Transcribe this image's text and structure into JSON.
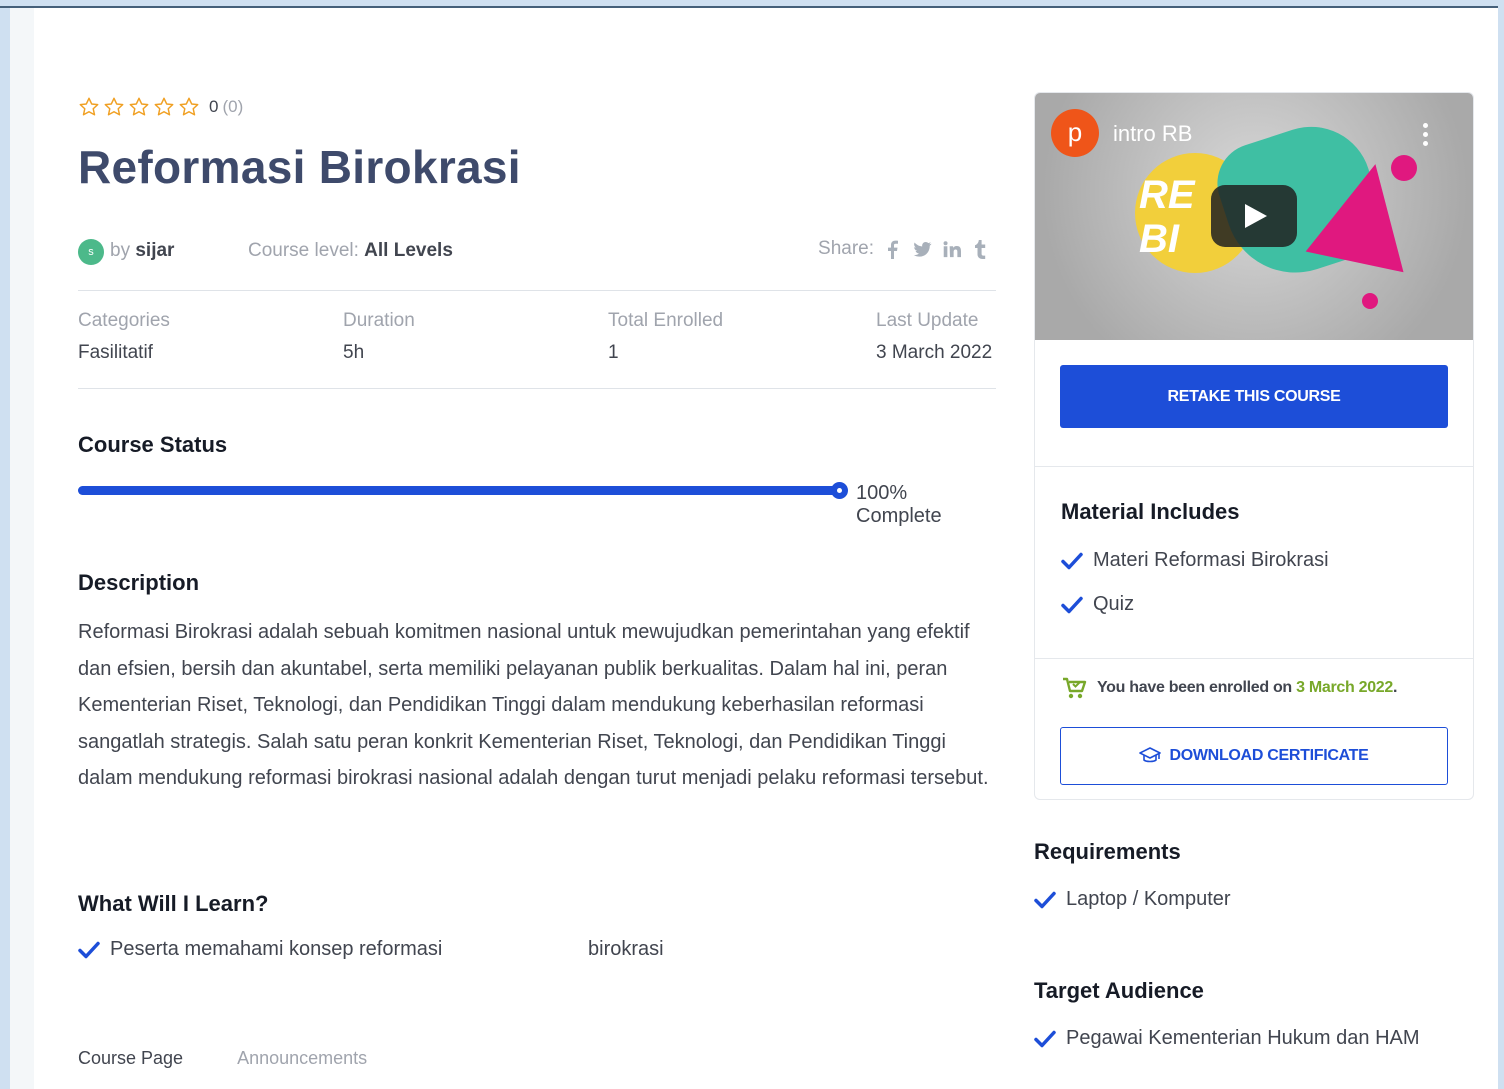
{
  "rating": {
    "value": "0",
    "count": "(0)",
    "stars_filled": 0,
    "stars_total": 5
  },
  "course": {
    "title": "Reformasi Birokrasi"
  },
  "author": {
    "avatar_letter": "s",
    "by_label": "by",
    "name": "sijar"
  },
  "level": {
    "label": "Course level:",
    "value": "All Levels"
  },
  "share": {
    "label": "Share:"
  },
  "info": [
    {
      "label": "Categories",
      "value": "Fasilitatif"
    },
    {
      "label": "Duration",
      "value": "5h"
    },
    {
      "label": "Total Enrolled",
      "value": "1"
    },
    {
      "label": "Last Update",
      "value": "3 March 2022"
    }
  ],
  "status": {
    "heading": "Course Status",
    "progress_percent": 100,
    "progress_text": "100% Complete"
  },
  "description": {
    "heading": "Description",
    "text": "Reformasi Birokrasi adalah sebuah komitmen nasional untuk mewujudkan pemerintahan yang efektif dan efsien, bersih dan akuntabel, serta memiliki pelayanan publik berkualitas. Dalam hal ini, peran Kementerian Riset, Teknologi, dan Pendidikan Tinggi dalam mendukung keberhasilan reformasi sangatlah strategis. Salah satu peran konkrit Kementerian Riset, Teknologi, dan Pendidikan Tinggi dalam mendukung reformasi birokrasi nasional adalah dengan turut menjadi pelaku reformasi tersebut."
  },
  "learn": {
    "heading": "What Will I Learn?",
    "items": [
      "Peserta memahami konsep reformasi",
      "birokrasi"
    ]
  },
  "tabs": [
    "Course Page",
    "Announcements"
  ],
  "video": {
    "channel_letter": "p",
    "title": "intro RB",
    "overlay_text": "RE BI"
  },
  "sidebar": {
    "retake_label": "RETAKE THIS COURSE",
    "material_heading": "Material Includes",
    "materials": [
      "Materi Reformasi Birokrasi",
      "Quiz"
    ],
    "enrolled_prefix": "You have been enrolled on",
    "enrolled_date": "3 March 2022",
    "enrolled_suffix": ".",
    "certificate_label": "DOWNLOAD CERTIFICATE",
    "requirements_heading": "Requirements",
    "requirements": [
      "Laptop / Komputer"
    ],
    "audience_heading": "Target Audience",
    "audience": [
      "Pegawai Kementerian Hukum dan HAM"
    ]
  },
  "colors": {
    "accent": "#1d4ed8",
    "title": "#3e4a6b",
    "star": "#f0a023",
    "enrolled_date": "#78a82a"
  },
  "icons": [
    "star-outline-icon",
    "facebook-icon",
    "twitter-icon",
    "linkedin-icon",
    "tumblr-icon",
    "check-icon",
    "cart-icon",
    "graduation-cap-icon",
    "play-icon",
    "more-vertical-icon"
  ]
}
